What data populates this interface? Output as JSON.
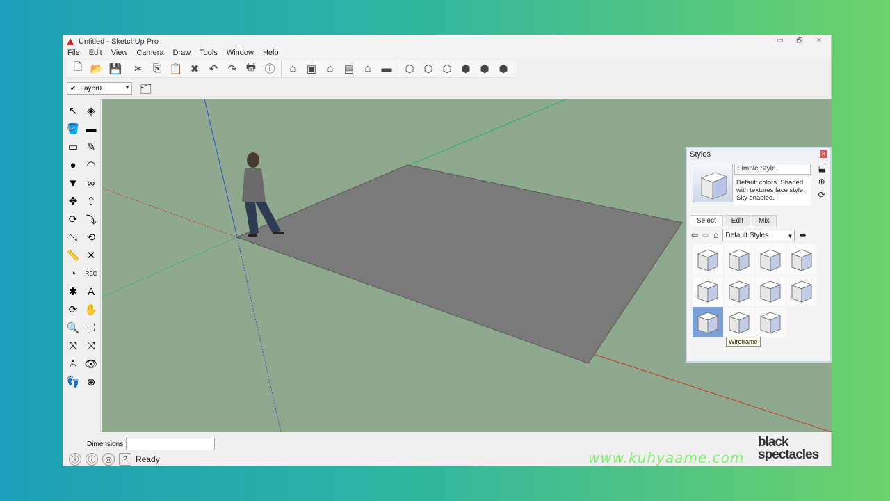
{
  "window": {
    "title": "Untitled - SketchUp Pro",
    "controls": [
      "▭",
      "🗗",
      "✕"
    ]
  },
  "menu": [
    "File",
    "Edit",
    "View",
    "Camera",
    "Draw",
    "Tools",
    "Window",
    "Help"
  ],
  "toolbar": {
    "groups": [
      [
        "new-icon",
        "open-icon",
        "save-icon"
      ],
      [
        "cut-icon",
        "copy-icon",
        "paste-icon",
        "erase-icon",
        "undo-icon",
        "redo-icon",
        "print-icon",
        "model-info-icon"
      ],
      [
        "iso-view-icon",
        "top-view-icon",
        "front-view-icon",
        "right-view-icon",
        "back-view-icon",
        "left-view-icon"
      ],
      [
        "xray-icon",
        "wireframe-icon",
        "hidden-line-icon",
        "shaded-icon",
        "shaded-textures-icon",
        "monochrome-icon"
      ]
    ],
    "glyphs": {
      "new-icon": "🗋",
      "open-icon": "📂",
      "save-icon": "💾",
      "cut-icon": "✂",
      "copy-icon": "⎘",
      "paste-icon": "📋",
      "erase-icon": "✖",
      "undo-icon": "↶",
      "redo-icon": "↷",
      "print-icon": "🖶",
      "model-info-icon": "ⓘ",
      "iso-view-icon": "⌂",
      "top-view-icon": "▣",
      "front-view-icon": "⌂",
      "right-view-icon": "▤",
      "back-view-icon": "⌂",
      "left-view-icon": "▬",
      "xray-icon": "⬡",
      "wireframe-icon": "⬡",
      "hidden-line-icon": "⬡",
      "shaded-icon": "⬢",
      "shaded-textures-icon": "⬢",
      "monochrome-icon": "⬢"
    }
  },
  "layers": {
    "current": "Layer0"
  },
  "left_tools": [
    [
      "select-icon",
      "↖"
    ],
    [
      "component-icon",
      "◈"
    ],
    [
      "paint-bucket-icon",
      "🪣"
    ],
    [
      "eraser-icon",
      "▬"
    ],
    [
      "rectangle-icon",
      "▭"
    ],
    [
      "line-icon",
      "✎"
    ],
    [
      "circle-icon",
      "●"
    ],
    [
      "arc-icon",
      "◠"
    ],
    [
      "polygon-icon",
      "▼"
    ],
    [
      "freehand-icon",
      "∞"
    ],
    [
      "move-icon",
      "✥"
    ],
    [
      "push-pull-icon",
      "⇧"
    ],
    [
      "rotate-icon",
      "⟳"
    ],
    [
      "follow-me-icon",
      "⤵"
    ],
    [
      "scale-icon",
      "⤡"
    ],
    [
      "offset-icon",
      "⟲"
    ],
    [
      "tape-measure-icon",
      "📏"
    ],
    [
      "dimension-icon",
      "✕"
    ],
    [
      "protractor-icon",
      "◔"
    ],
    [
      "text-icon",
      "REC"
    ],
    [
      "axes-icon",
      "✱"
    ],
    [
      "3d-text-icon",
      "A"
    ],
    [
      "orbit-icon",
      "⟳"
    ],
    [
      "pan-icon",
      "✋"
    ],
    [
      "zoom-icon",
      "🔍"
    ],
    [
      "zoom-window-icon",
      "⛶"
    ],
    [
      "zoom-extents-icon",
      "⤧"
    ],
    [
      "previous-view-icon",
      "⤨"
    ],
    [
      "position-camera-icon",
      "♙"
    ],
    [
      "look-around-icon",
      "👁"
    ],
    [
      "walk-icon",
      "👣"
    ],
    [
      "section-plane-icon",
      "⊕"
    ]
  ],
  "bottom": {
    "dimensions_label": "Dimensions",
    "dimensions_value": "",
    "status": "Ready"
  },
  "styles_panel": {
    "title": "Styles",
    "style_name": "Simple Style",
    "description": "Default colors.  Shaded with textures face style.  Sky enabled.",
    "tabs": [
      "Select",
      "Edit",
      "Mix"
    ],
    "active_tab": "Select",
    "collection": "Default Styles",
    "tooltip": "Wireframe",
    "style_count": 11,
    "selected_index": 8
  },
  "overlay": {
    "url": "www.kuhyaame.com",
    "logo_line1": "black",
    "logo_line2": "spectacles"
  },
  "colors": {
    "ground": "#8fa98f",
    "face": "#7a7a7a",
    "red_axis": "#c0392b",
    "green_axis": "#27ae60",
    "blue_axis": "#2e50c8"
  }
}
